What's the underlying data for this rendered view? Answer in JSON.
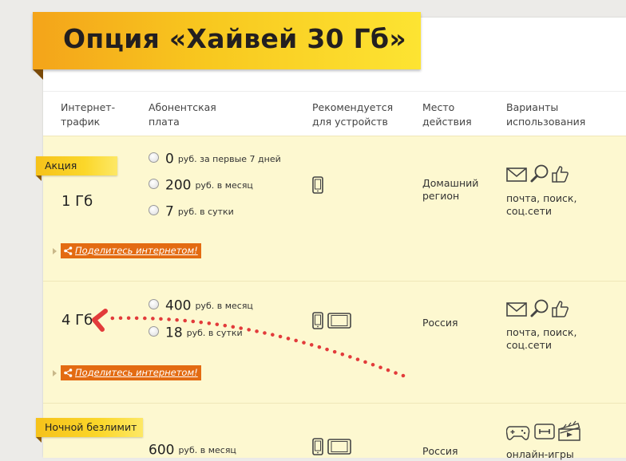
{
  "title": "Опция «Хайвей 30 Гб»",
  "columns": {
    "traffic": "Интернет-\nтрафик",
    "fee": "Абонентская\nплата",
    "devices": "Рекомендуется\nдля устройств",
    "region": "Место\nдействия",
    "usage": "Варианты\nиспользования"
  },
  "rows": [
    {
      "tag": "Акция",
      "volume": "1 Гб",
      "prices": [
        {
          "value": "0",
          "unit": "руб. за первые 7 дней"
        },
        {
          "value": "200",
          "unit": "руб. в месяц"
        },
        {
          "value": "7",
          "unit": "руб. в сутки"
        }
      ],
      "region": "Домашний\nрегион",
      "usage": "почта, поиск,\nсоц.сети",
      "share": "Поделитесь интернетом!"
    },
    {
      "volume": "4 Гб",
      "prices": [
        {
          "value": "400",
          "unit": "руб. в месяц"
        },
        {
          "value": "18",
          "unit": "руб. в сутки"
        }
      ],
      "region": "Россия",
      "usage": "почта, поиск,\nсоц.сети",
      "share": "Поделитесь интернетом!"
    },
    {
      "tag": "Ночной безлимит",
      "prices": [
        {
          "value": "600",
          "unit": "руб. в месяц"
        }
      ],
      "region": "Россия",
      "usage": "онлайн-игры"
    }
  ],
  "colors": {
    "accent_yellow": "#f8c81f",
    "row_bg": "#fdf8d0",
    "share_orange": "#e36b12",
    "arrow_red": "#e23b3b"
  }
}
